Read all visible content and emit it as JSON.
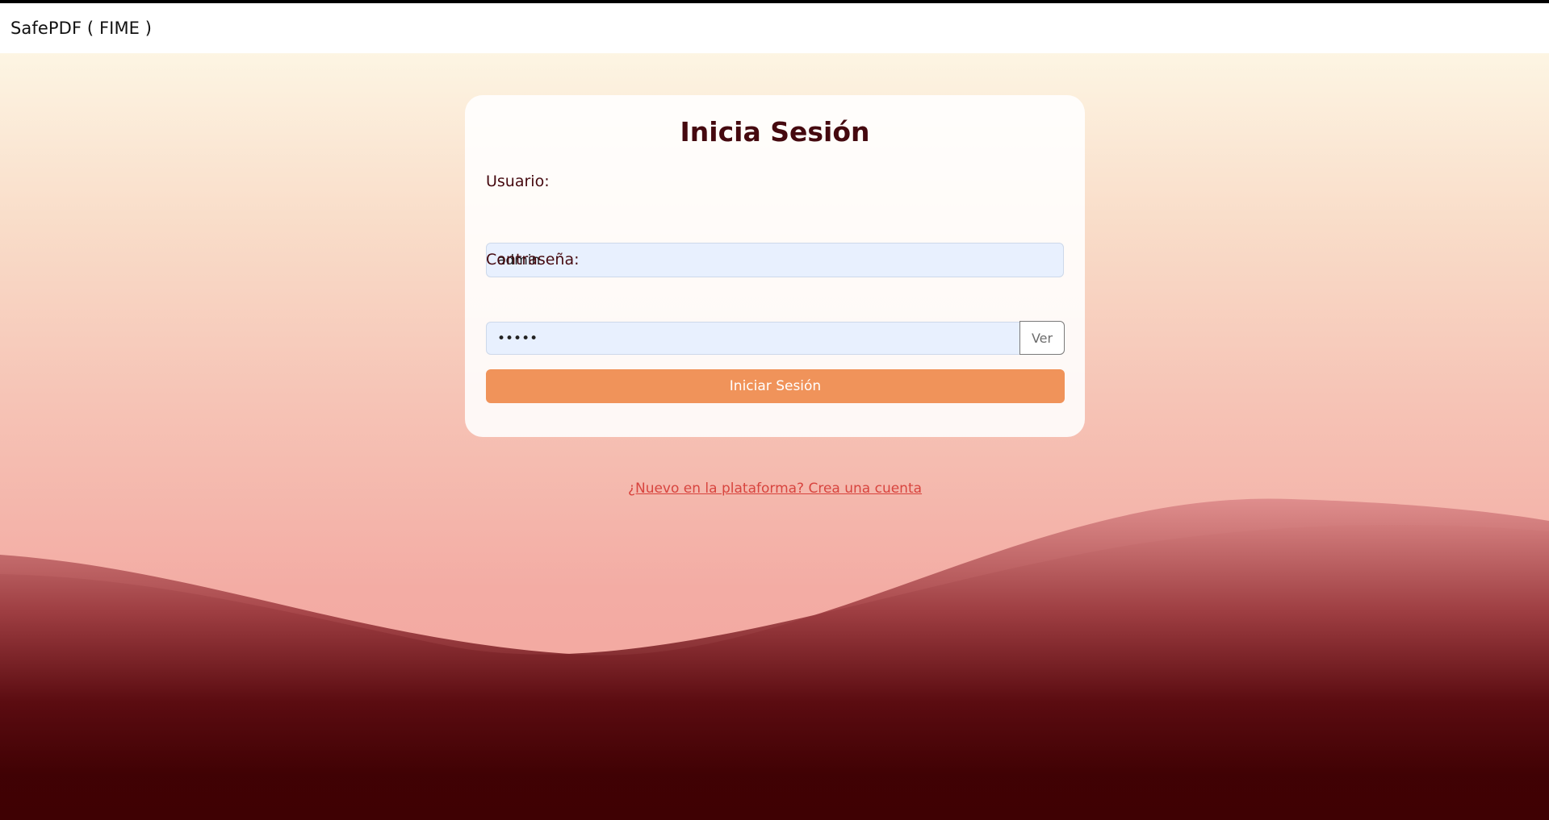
{
  "navbar": {
    "brand": "SafePDF ( FIME )"
  },
  "login": {
    "title": "Inicia Sesión",
    "username_label": "Usuario:",
    "username_value": "admin",
    "password_label": "Contraseña:",
    "password_value": "•••••",
    "show_password_label": "Ver",
    "submit_label": "Iniciar Sesión",
    "signup_link": "¿Nuevo en la plataforma? Crea una cuenta"
  },
  "colors": {
    "accent": "#f0935a",
    "title": "#45090f",
    "link": "#d8443e",
    "input_bg": "#e8f0fe",
    "wave_dark": "#3f0103"
  }
}
